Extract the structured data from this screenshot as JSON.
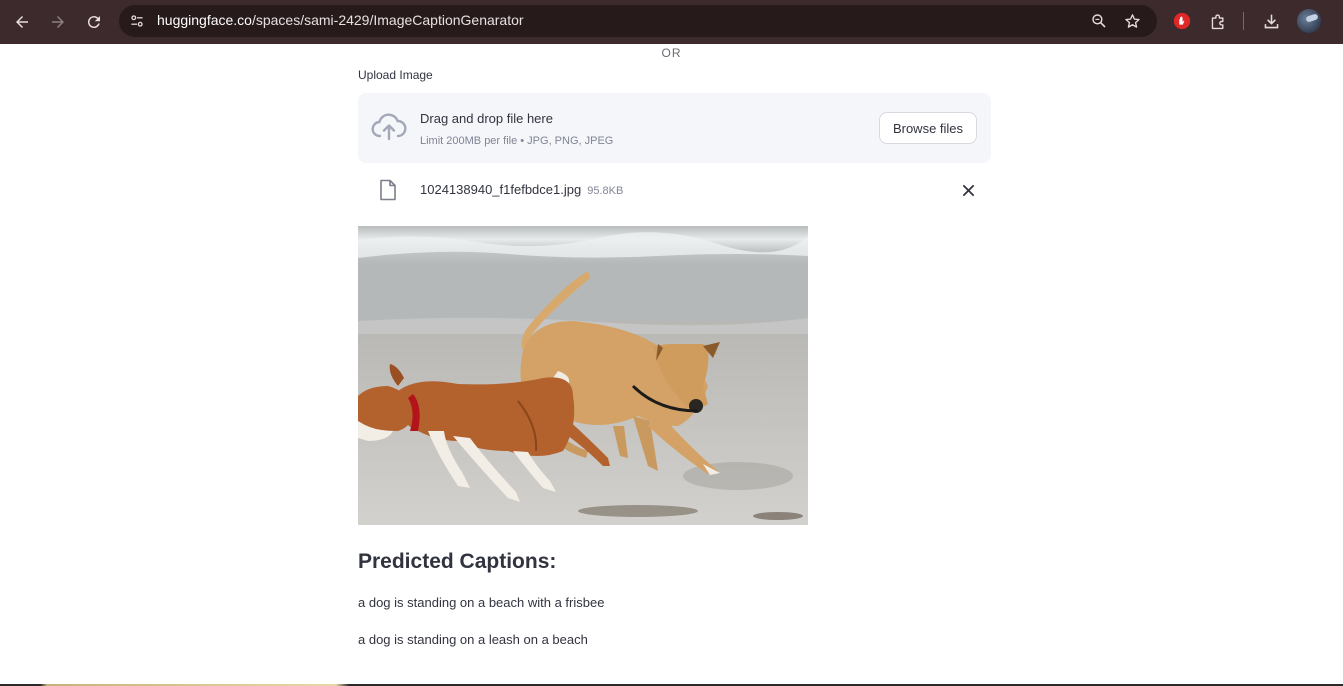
{
  "browser": {
    "url_host": "huggingface.co",
    "url_path": "/spaces/sami-2429/ImageCaptionGenarator",
    "icons": [
      "back-arrow-icon",
      "forward-arrow-icon",
      "reload-icon",
      "site-settings-icon",
      "zoom-icon",
      "bookmark-star-icon",
      "extension-red-icon",
      "extensions-puzzle-icon",
      "download-icon",
      "profile-avatar"
    ]
  },
  "app": {
    "or_text": "OR",
    "upload_label": "Upload Image",
    "dropzone": {
      "title": "Drag and drop file here",
      "subtitle": "Limit 200MB per file • JPG, PNG, JPEG",
      "browse_label": "Browse files"
    },
    "file": {
      "name": "1024138940_f1fefbdce1.jpg",
      "size": "95.8KB"
    },
    "captions_title": "Predicted Captions:",
    "captions": [
      "a dog is standing on a beach with a frisbee",
      "a dog is standing on a leash on a beach"
    ]
  },
  "colors": {
    "toolbar_bg": "#3c2a2c",
    "omnibox_bg": "#261a1b",
    "dropzone_bg": "#f5f6f9",
    "text": "#31333f",
    "muted_text": "#808495"
  }
}
